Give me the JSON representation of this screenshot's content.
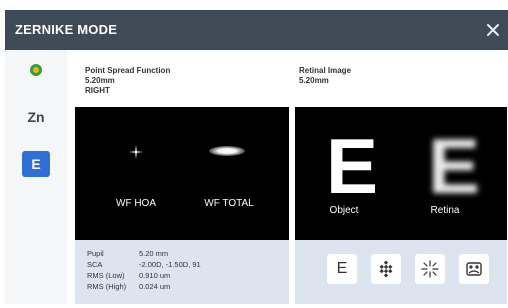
{
  "window": {
    "title": "ZERNIKE MODE",
    "close_icon": "close-icon"
  },
  "sidebar": {
    "items": [
      {
        "name": "color-mode",
        "label": "",
        "icon": "color-circle-icon",
        "active": false
      },
      {
        "name": "zn",
        "label": "Zn",
        "active": false
      },
      {
        "name": "e",
        "label": "E",
        "active": true
      }
    ],
    "accent": "#2f6fd6"
  },
  "psf": {
    "heading": "Point Spread Function",
    "pupil": "5.20mm",
    "eye": "RIGHT",
    "labels": [
      "WF HOA",
      "WF TOTAL"
    ]
  },
  "retinal": {
    "heading": "Retinal Image",
    "pupil": "5.20mm",
    "labels": [
      "Object",
      "Retina"
    ],
    "letter": "E"
  },
  "info": {
    "rows": [
      {
        "key": "Pupil",
        "value": "5.20 mm"
      },
      {
        "key": "SCA",
        "value": "-2.00D, -1.50D, 91"
      },
      {
        "key": "RMS (Low)",
        "value": "0.910 um"
      },
      {
        "key": "RMS (High)",
        "value": "0.024 um"
      }
    ]
  },
  "tools": [
    {
      "name": "letter-e-tool",
      "glyph": "E",
      "icon": "letter-e-icon"
    },
    {
      "name": "checker-tool",
      "glyph": "",
      "icon": "checker-diamond-icon"
    },
    {
      "name": "starburst-tool",
      "glyph": "",
      "icon": "starburst-icon"
    },
    {
      "name": "scene-tool",
      "glyph": "",
      "icon": "scene-image-icon"
    }
  ]
}
